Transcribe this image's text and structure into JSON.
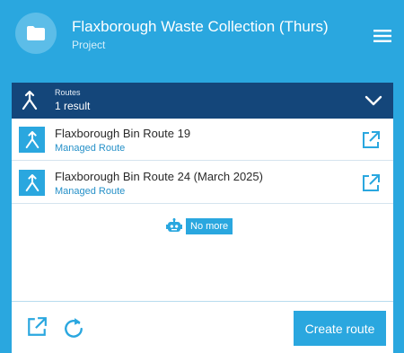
{
  "header": {
    "title": "Flaxborough Waste Collection (Thurs)",
    "subtitle": "Project",
    "icon": "folder-icon",
    "menu_icon": "hamburger-menu-icon"
  },
  "routes_section": {
    "label": "Routes",
    "count": "1 result",
    "icon": "merge-arrow-icon",
    "toggle_icon": "chevron-down-icon"
  },
  "routes": [
    {
      "name": "Flaxborough Bin Route 19",
      "type": "Managed Route"
    },
    {
      "name": "Flaxborough Bin Route 24 (March 2025)",
      "type": "Managed Route"
    }
  ],
  "status": {
    "no_more": "No more",
    "icon": "robot-icon"
  },
  "footer": {
    "create_label": "Create route",
    "open_icon": "external-link-icon",
    "refresh_icon": "refresh-icon"
  },
  "colors": {
    "accent": "#2aa7df",
    "dark_bar": "#14467a",
    "link_text": "#2590c8"
  }
}
